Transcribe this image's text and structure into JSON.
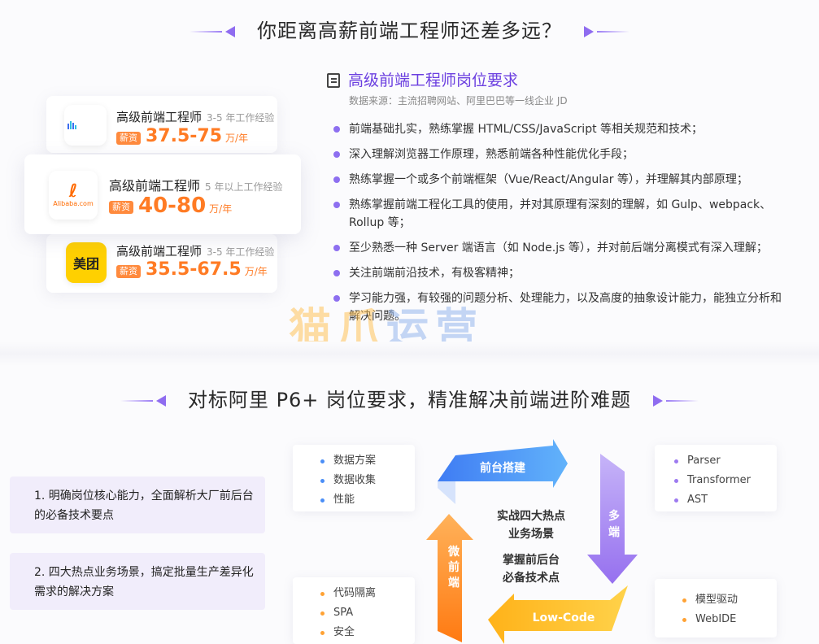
{
  "top_title": "你距离高薪前端工程师还差多远？",
  "jobs": [
    {
      "company": "字节跳动",
      "title": "高级前端工程师",
      "experience": "3-5 年工作经验",
      "salary_tag": "薪资",
      "salary": "37.5-75",
      "unit": "万/年"
    },
    {
      "company": "Alibaba.com",
      "title": "高级前端工程师",
      "experience": "5 年以上工作经验",
      "salary_tag": "薪资",
      "salary": "40-80",
      "unit": "万/年"
    },
    {
      "company": "美团",
      "title": "高级前端工程师",
      "experience": "3-5 年工作经验",
      "salary_tag": "薪资",
      "salary": "35.5-67.5",
      "unit": "万/年"
    }
  ],
  "requirements": {
    "heading": "高级前端工程师岗位要求",
    "source": "数据来源：主流招聘网站、阿里巴巴等一线企业 JD",
    "items": [
      "前端基础扎实，熟练掌握 HTML/CSS/JavaScript 等相关规范和技术；",
      "深入理解浏览器工作原理，熟悉前端各种性能优化手段；",
      "熟练掌握一个或多个前端框架（Vue/React/Angular 等），并理解其内部原理；",
      "熟练掌握前端工程化工具的使用，并对其原理有深刻的理解，如 Gulp、webpack、Rollup 等；",
      "至少熟悉一种 Server 端语言（如 Node.js 等），并对前后端分离模式有深入理解；",
      "关注前端前沿技术，有极客精神；",
      "学习能力强，有较强的问题分析、处理能力，以及高度的抽象设计能力，能独立分析和解决问题。"
    ]
  },
  "watermark": {
    "part1": "猫爪",
    "part2": "运营"
  },
  "second_title": "对标阿里 P6+ 岗位要求，精准解决前端进阶难题",
  "benefits": [
    "1. 明确岗位核心能力，全面解析大厂前后台的必备技术要点",
    "2. 四大热点业务场景，搞定批量生产差异化需求的解决方案"
  ],
  "diagram": {
    "center": {
      "line1": "实战四大热点",
      "line2": "业务场景",
      "line3": "掌握前后台",
      "line4": "必备技术点"
    },
    "arrows": {
      "top": "前台搭建",
      "right": [
        "多",
        "端"
      ],
      "bottom": "Low-Code",
      "left": [
        "微",
        "前",
        "端"
      ]
    },
    "boxes": {
      "top_left": [
        "数据方案",
        "数据收集",
        "性能"
      ],
      "top_right": [
        "Parser",
        "Transformer",
        "AST"
      ],
      "bottom_left": [
        "代码隔离",
        "SPA",
        "安全"
      ],
      "bottom_right": [
        "模型驱动",
        "WebIDE"
      ]
    }
  },
  "colors": {
    "accent": "#6b3fe0",
    "salary": "#ff7b24",
    "blue": "#3f7cf3",
    "purple": "#a07df2",
    "orange": "#ff9a1f"
  }
}
